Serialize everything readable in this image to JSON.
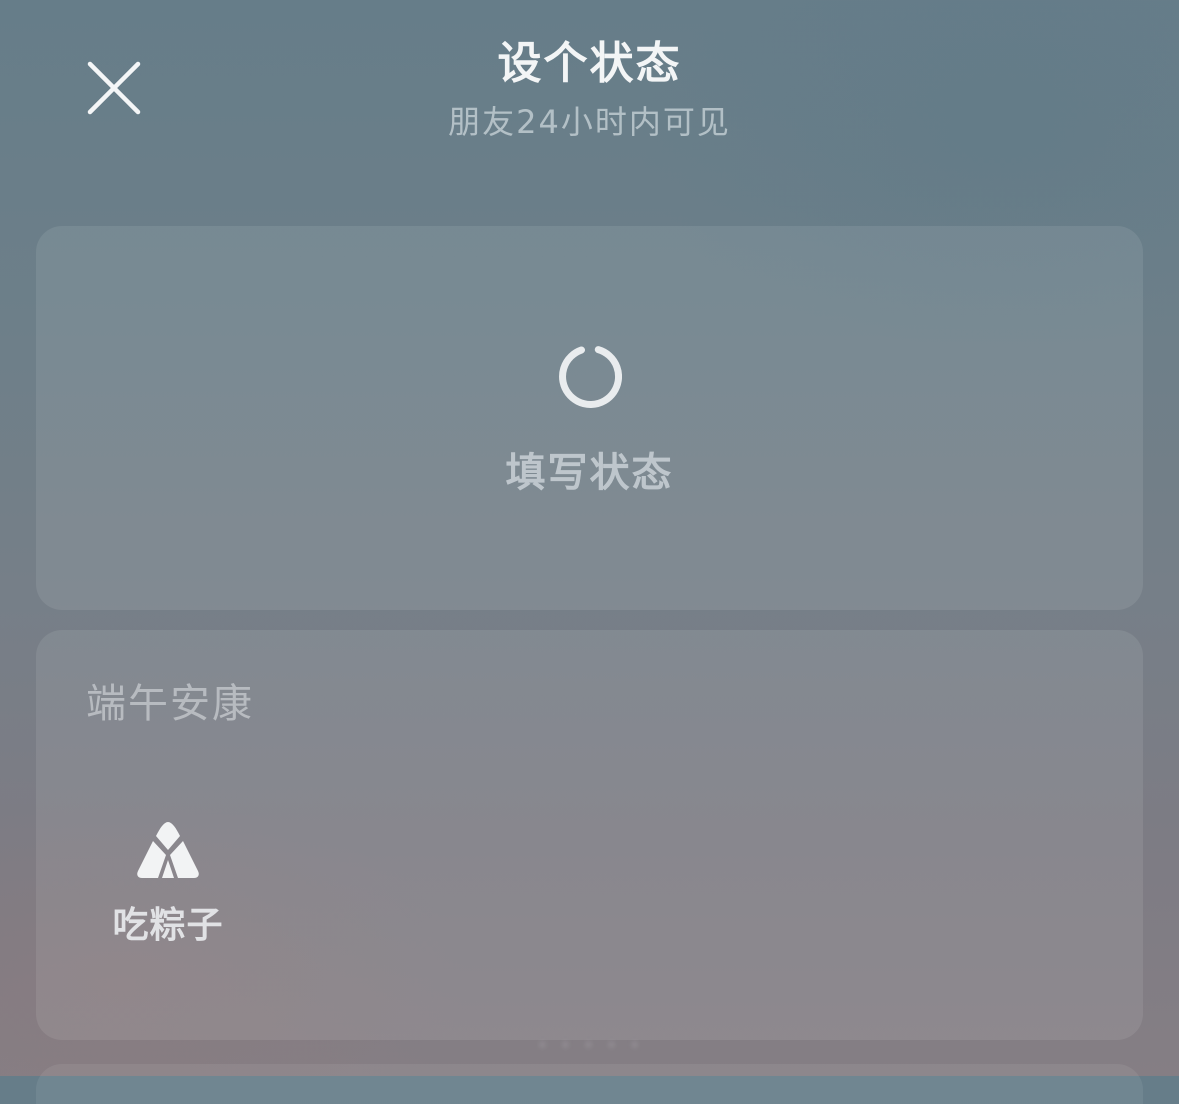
{
  "header": {
    "title": "设个状态",
    "subtitle": "朋友24小时内可见",
    "close_icon": "close-icon"
  },
  "compose": {
    "label": "填写状态",
    "icon": "loading-spinner-icon"
  },
  "festival": {
    "section_title": "端午安康",
    "options": [
      {
        "label": "吃粽子",
        "icon": "zongzi-icon"
      }
    ]
  },
  "colors": {
    "title_text": "#f3f5f6",
    "background_top": "#667d89",
    "background_bottom": "#857e84"
  }
}
